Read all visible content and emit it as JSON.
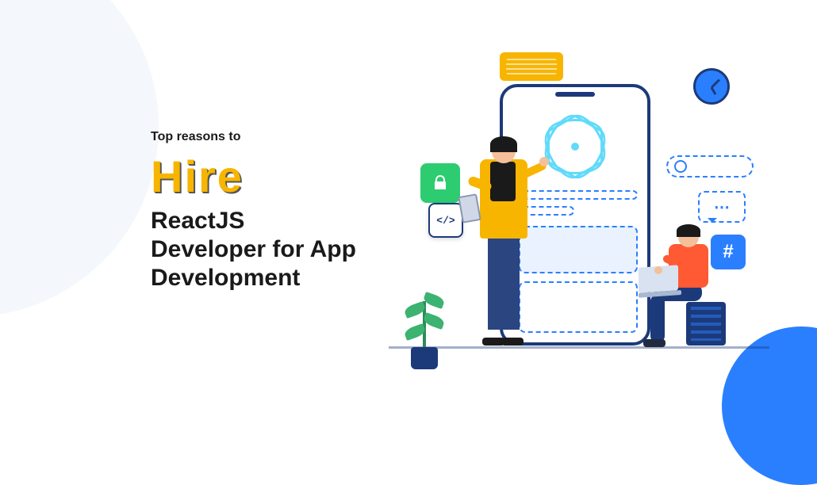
{
  "text": {
    "kicker": "Top reasons to",
    "hire": "Hire",
    "subtitle": "ReactJS Developer for App Development"
  },
  "icons": {
    "code_tag": "</>",
    "hash": "#"
  },
  "colors": {
    "accent_yellow": "#f7b500",
    "accent_blue": "#2a7fff",
    "dark_navy": "#1c3a7a",
    "green": "#2ecc71",
    "orange": "#ff5a33",
    "react": "#61dafb"
  }
}
